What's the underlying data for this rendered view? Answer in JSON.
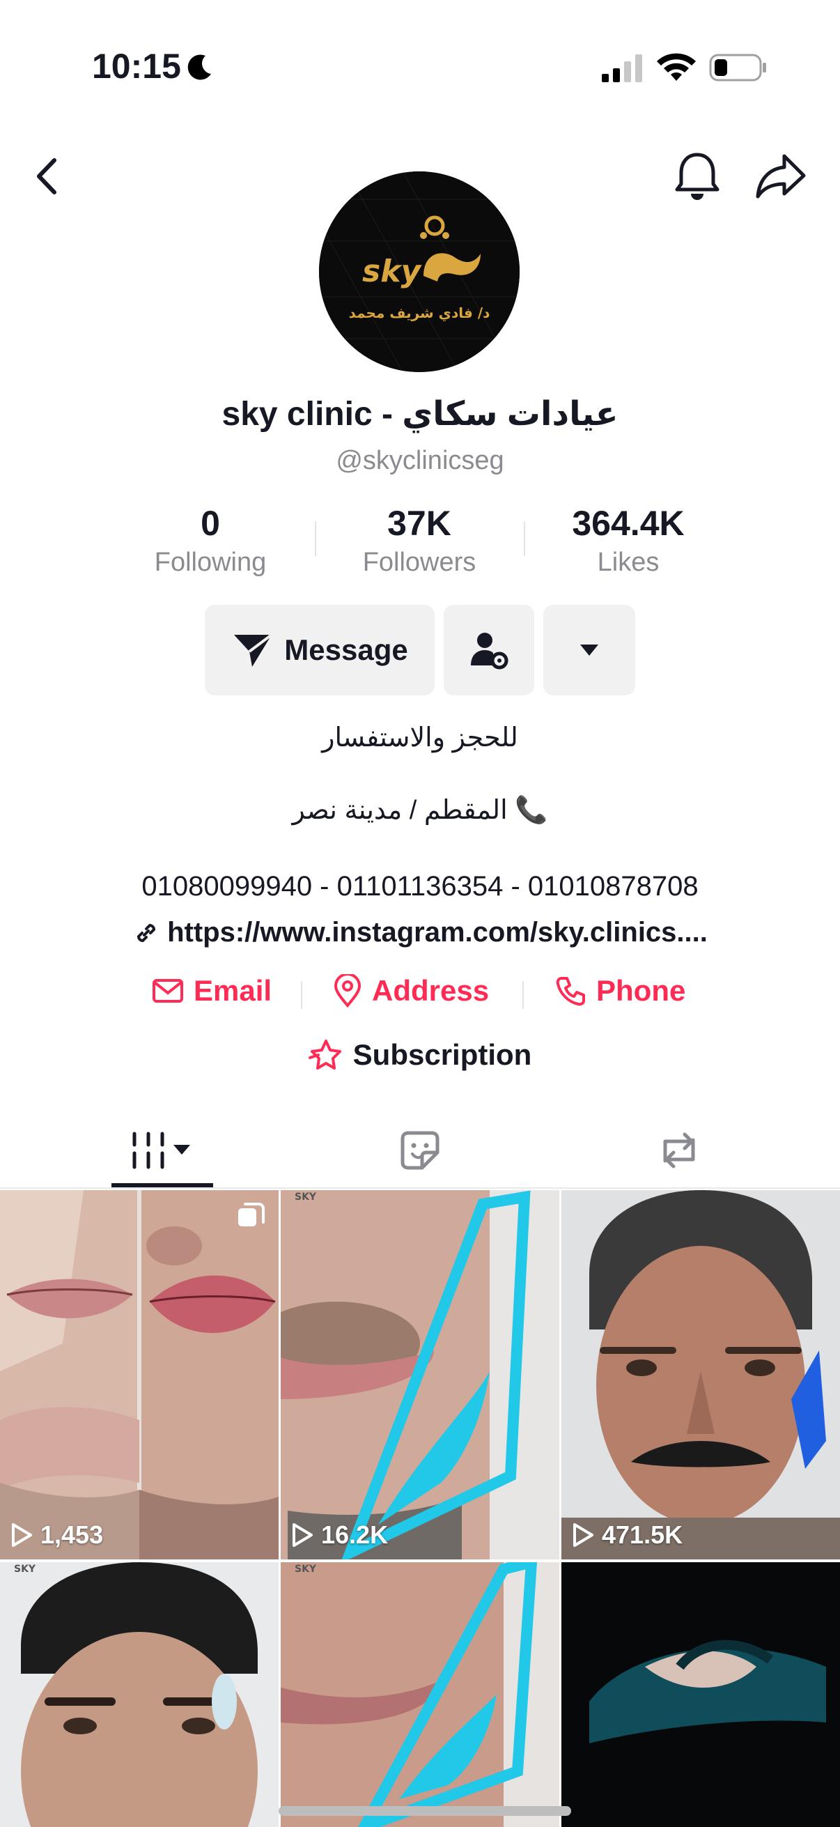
{
  "status_bar": {
    "time": "10:15",
    "icons": [
      "moon-icon",
      "cellular-signal-icon",
      "wifi-icon",
      "battery-icon"
    ]
  },
  "nav": {
    "icons": [
      "back-chevron-icon",
      "bell-icon",
      "share-icon"
    ]
  },
  "profile": {
    "avatar_brand": "sky",
    "avatar_subtitle": "د/ فادي شريف محمد",
    "name": "sky clinic - عيادات سكاي",
    "handle": "@skyclinicseg"
  },
  "stats": [
    {
      "value": "0",
      "label": "Following"
    },
    {
      "value": "37K",
      "label": "Followers"
    },
    {
      "value": "364.4K",
      "label": "Likes"
    }
  ],
  "actions": {
    "message_label": "Message"
  },
  "bio": {
    "line1": "للحجز والاستفسار",
    "line2": "المقطم / مدينة نصر 📞",
    "phones": "01080099940 - 01101136354 - 01010878708",
    "link": "https://www.instagram.com/sky.clinics...."
  },
  "contacts": {
    "email": "Email",
    "address": "Address",
    "phone": "Phone"
  },
  "subscription": {
    "label": "Subscription"
  },
  "tabs": [
    "videos-tab",
    "liked-tab",
    "reposts-tab"
  ],
  "videos": [
    {
      "views": "1,453",
      "multi": true
    },
    {
      "views": "16.2K"
    },
    {
      "views": "471.5K"
    },
    {
      "views": ""
    },
    {
      "views": ""
    },
    {
      "views": ""
    }
  ],
  "colors": {
    "accent": "#fe2c55",
    "text": "#161823",
    "muted": "#8a8b91",
    "button_bg": "#f1f1f2"
  }
}
